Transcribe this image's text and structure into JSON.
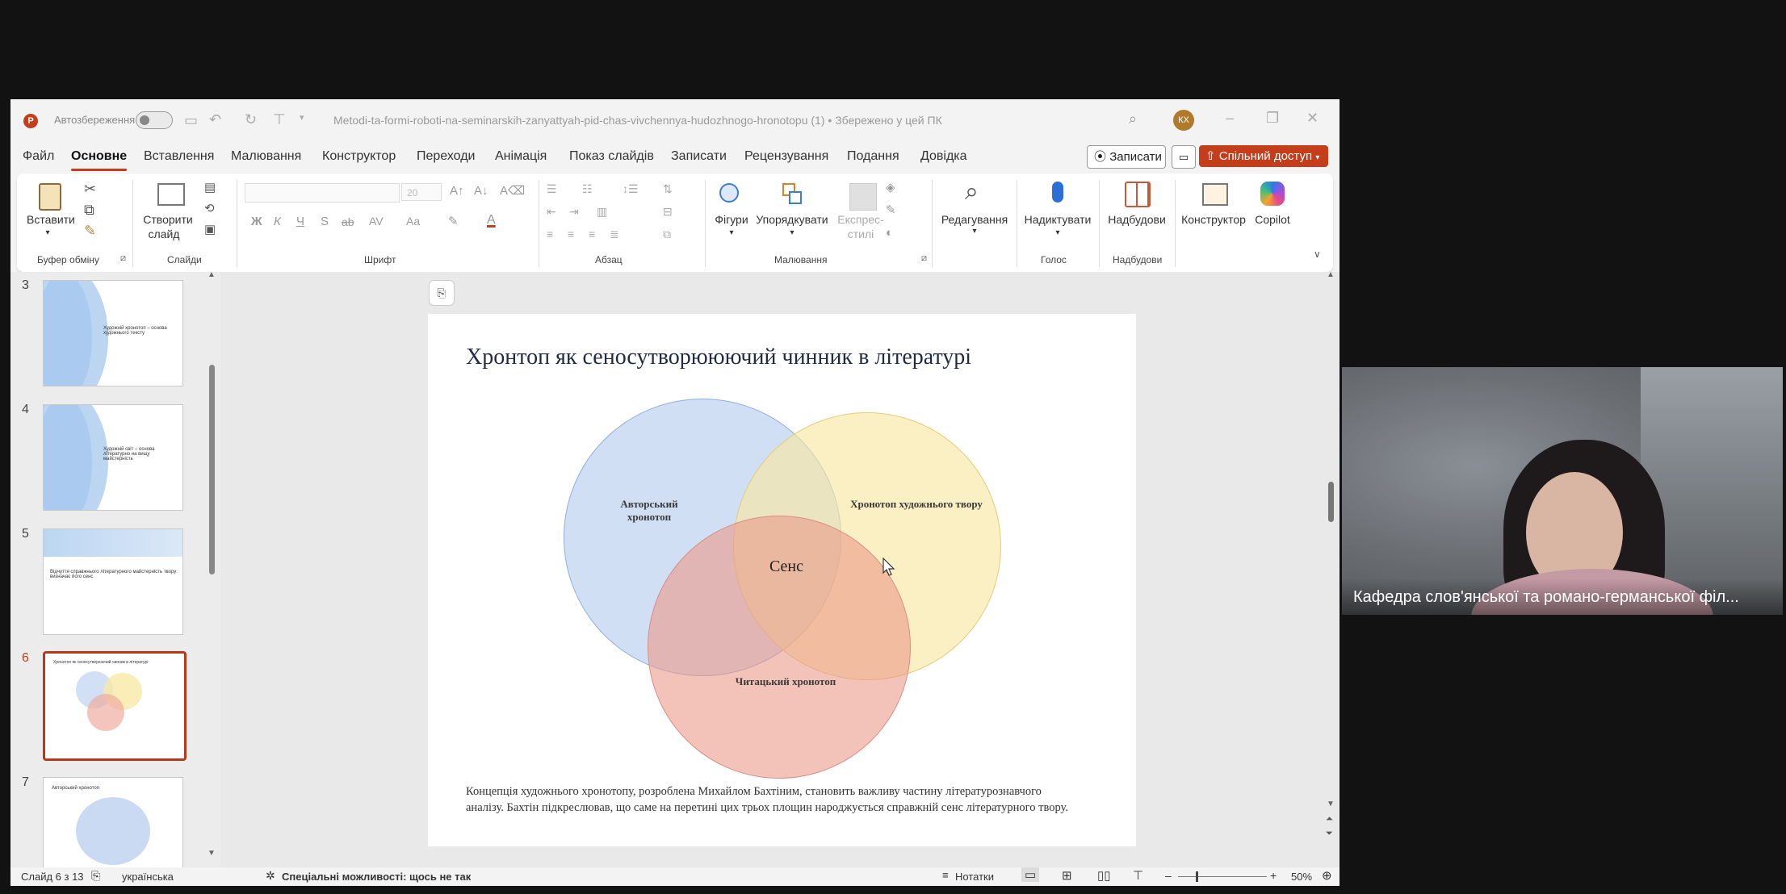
{
  "window": {
    "autosave_label": "Автозбереження",
    "file_title": "Metodi-ta-formi-roboti-na-seminarskih-zanyattyah-pid-chas-vivchennya-hudozhnogo-hronotopu (1) • Збережено у цей ПК",
    "user_initials": "КХ",
    "app_icon": "powerpoint-icon"
  },
  "menu": {
    "tabs": [
      "Файл",
      "Основне",
      "Вставлення",
      "Малювання",
      "Конструктор",
      "Переходи",
      "Анімація",
      "Показ слайдів",
      "Записати",
      "Рецензування",
      "Подання",
      "Довідка"
    ],
    "active_tab": "Основне",
    "record_button": "Записати",
    "share_button": "Спільний доступ"
  },
  "ribbon": {
    "paste": "Вставити",
    "new_slide_line1": "Створити",
    "new_slide_line2": "слайд",
    "font_size": "20",
    "shapes": "Фігури",
    "arrange": "Упорядкувати",
    "express_styles_line1": "Експрес-",
    "express_styles_line2": "стилі",
    "editing": "Редагування",
    "dictate": "Надиктувати",
    "addins": "Надбудови",
    "designer": "Конструктор",
    "copilot": "Copilot",
    "groups": {
      "clipboard": "Буфер обміну",
      "slides": "Слайди",
      "font": "Шрифт",
      "paragraph": "Абзац",
      "drawing": "Малювання",
      "voice": "Голос",
      "addins": "Надбудови"
    },
    "font_buttons": {
      "bold": "Ж",
      "italic": "К",
      "underline": "Ч",
      "shadow": "S",
      "strike": "ab",
      "spacing": "AV",
      "case": "Aa"
    }
  },
  "thumbnails": [
    {
      "number": "3",
      "text": "Художній хронотоп – основа художнього тексту"
    },
    {
      "number": "4",
      "text": "Художній світ – основа літературно на вищу майстерність"
    },
    {
      "number": "5",
      "text": "Відчуття справжнього літературного майстерність твору: визначає його сенс"
    },
    {
      "number": "6",
      "text": "Хронотоп як сеносутворюючий чинник в літературі"
    },
    {
      "number": "7",
      "text": "Авторський хронотоп"
    }
  ],
  "slide": {
    "title": "Хронтоп як сеносутворююючий чинник в літературі",
    "venn": {
      "author": "Авторський хронотоп",
      "work": "Хронотоп художнього твору",
      "reader": "Читацький хронотоп",
      "center": "Сенс",
      "colors": {
        "author": "#c9daf2",
        "work": "#f8e9a6",
        "reader": "#f0aca0"
      }
    },
    "body": "Концепція художнього хронотопу, розроблена Михайлом Бахтіним, становить важливу частину літературознавчого аналізу. Бахтін підкреслював, що саме на перетині цих трьох площин народжується справжній сенс літературного твору."
  },
  "status": {
    "slide_indicator": "Слайд 6 з 13",
    "language": "українська",
    "accessibility": "Спеціальні можливості: щось не так",
    "notes": "Нотатки",
    "zoom": "50%"
  },
  "video": {
    "caption": "Кафедра слов'янської та романо-германської філ..."
  },
  "colors": {
    "accent": "#c43e1c",
    "share": "#c43e1c"
  }
}
